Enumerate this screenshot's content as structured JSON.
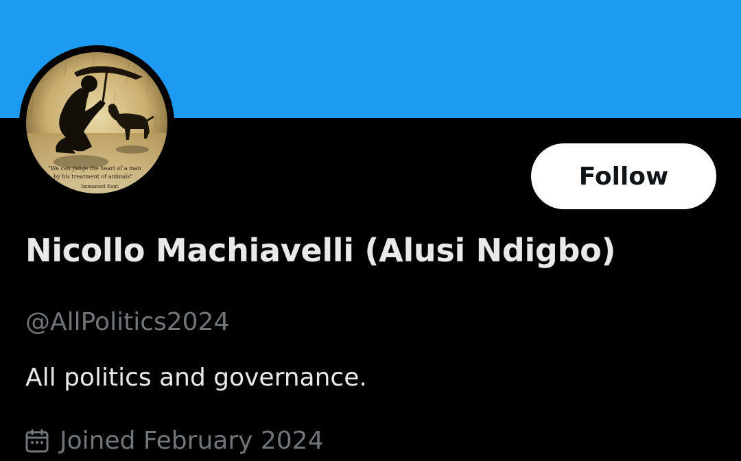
{
  "colors": {
    "banner": "#1d9bf0",
    "background": "#000000",
    "primary_text": "#e7e9ea",
    "secondary_text": "#71767b",
    "follow_button_bg": "#ffffff",
    "follow_button_text": "#0f1419"
  },
  "profile": {
    "avatar_icon": "avatar-photo",
    "avatar_caption_lines": [
      "\"We can judge the heart of a man",
      "by his treatment of animals\"",
      "Immanuel Kant"
    ],
    "display_name": "Nicollo Machiavelli (Alusi Ndigbo)",
    "handle": "@AllPolitics2024",
    "bio": "All politics and governance.",
    "joined_icon": "calendar-icon",
    "joined": "Joined February 2024"
  },
  "actions": {
    "follow_label": "Follow"
  }
}
